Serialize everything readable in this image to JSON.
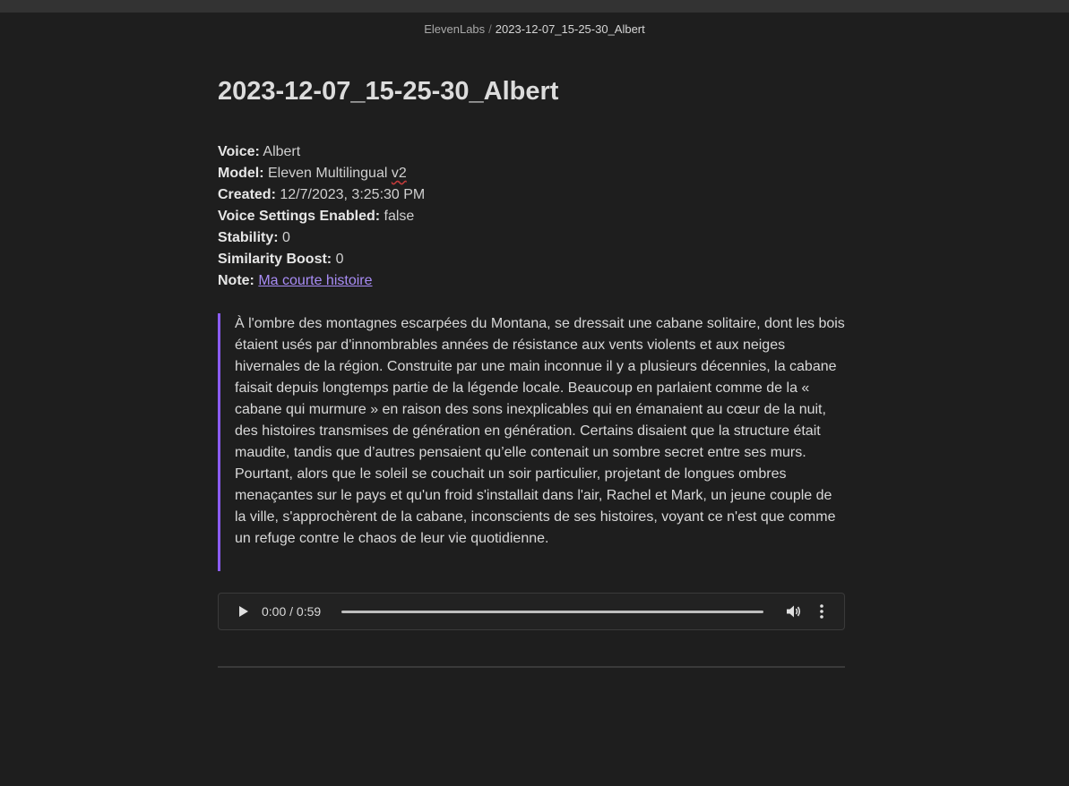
{
  "breadcrumb": {
    "root": "ElevenLabs",
    "separator": "/",
    "current": "2023-12-07_15-25-30_Albert"
  },
  "page": {
    "title": "2023-12-07_15-25-30_Albert"
  },
  "meta": {
    "voice_label": "Voice:",
    "voice_value": "Albert",
    "model_label": "Model:",
    "model_value": "Eleven Multilingual",
    "model_version": "v2",
    "created_label": "Created:",
    "created_value": "12/7/2023, 3:25:30 PM",
    "settings_label": "Voice Settings Enabled:",
    "settings_value": "false",
    "stability_label": "Stability:",
    "stability_value": "0",
    "similarity_label": "Similarity Boost:",
    "similarity_value": "0",
    "note_label": "Note:",
    "note_value": "Ma courte histoire"
  },
  "story": {
    "text": "À l'ombre des montagnes escarpées du Montana, se dressait une cabane solitaire, dont les bois étaient usés par d'innombrables années de résistance aux vents violents et aux neiges hivernales de la région. Construite par une main inconnue il y a plusieurs décennies, la cabane faisait depuis longtemps partie de la légende locale. Beaucoup en parlaient comme de la « cabane qui murmure » en raison des sons inexplicables qui en émanaient au cœur de la nuit, des histoires transmises de génération en génération. Certains disaient que la structure était maudite, tandis que d’autres pensaient qu’elle contenait un sombre secret entre ses murs. Pourtant, alors que le soleil se couchait un soir particulier, projetant de longues ombres menaçantes sur le pays et qu'un froid s'installait dans l'air, Rachel et Mark, un jeune couple de la ville, s'approchèrent de la cabane, inconscients de ses histoires, voyant ce n'est que comme un refuge contre le chaos de leur vie quotidienne."
  },
  "audio": {
    "time_display": "0:00 / 0:59",
    "play_icon": "play-icon",
    "volume_icon": "volume-icon",
    "more_icon": "more-vertical-icon"
  },
  "colors": {
    "background": "#1e1e1e",
    "accent": "#8b5cf6",
    "link": "#a88cf5"
  }
}
